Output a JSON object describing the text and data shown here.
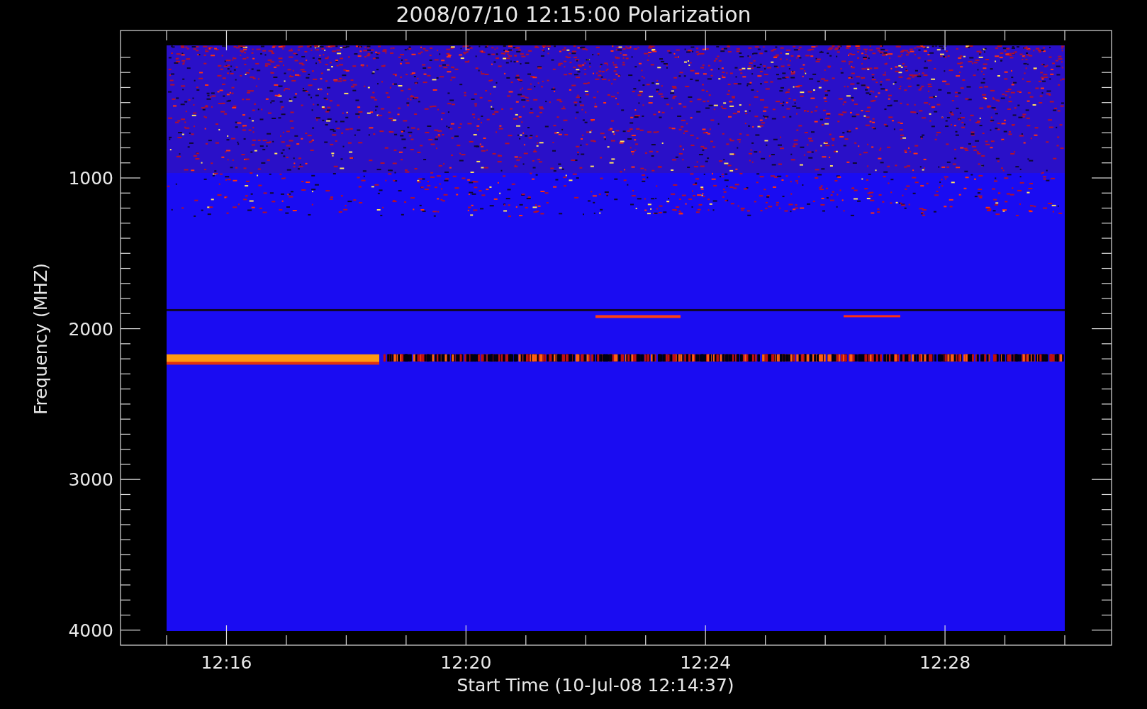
{
  "chart": {
    "title": "2008/07/10 12:15:00 Polarization",
    "xlabel": "Start Time (10-Jul-08 12:14:37)",
    "ylabel": "Frequency (MHZ)",
    "yticks": [
      "1000",
      "2000",
      "3000",
      "4000"
    ],
    "xticks": [
      "12:16",
      "12:20",
      "12:24",
      "12:28"
    ]
  }
}
